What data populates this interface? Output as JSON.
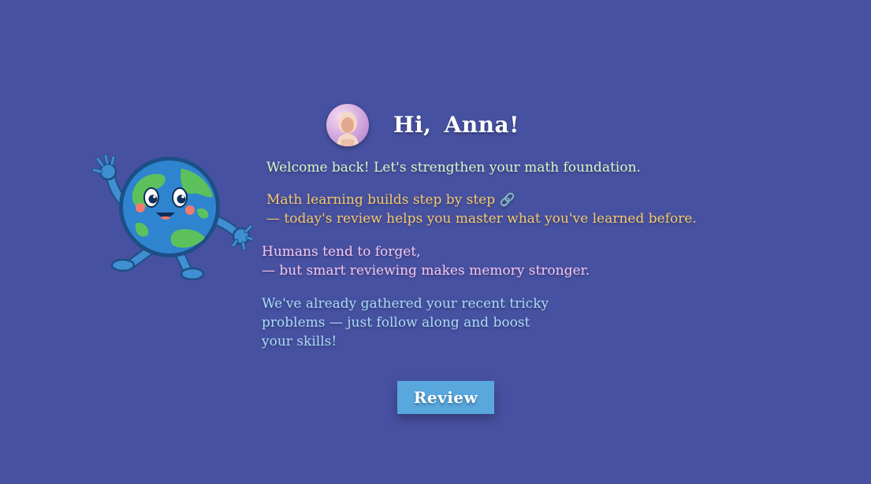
{
  "greeting": {
    "text": "Hi, Anna!"
  },
  "messages": {
    "welcome": "Welcome back! Let's strengthen your math foundation.",
    "steps_line1": "Math learning builds step by step",
    "steps_icon": "link-icon",
    "steps_line2": "— today's review helps you master what you've learned before.",
    "forget_line1": "Humans tend to forget,",
    "forget_line2": "— but smart reviewing makes memory stronger.",
    "tricky_line1": "We've already gathered your recent tricky",
    "tricky_line2": "problems — just follow along and boost",
    "tricky_line3": "your skills!"
  },
  "actions": {
    "review_label": "Review"
  },
  "images": {
    "mascot": "smiling-earth-globe-mascot",
    "avatar": "girl-avatar"
  },
  "colors": {
    "background": "#4751a1",
    "welcome_text": "#d9f7c5",
    "steps_text": "#f3c96a",
    "forget_text": "#f5c6ef",
    "tricky_text": "#a9dcf6",
    "review_button": "#58a7dd"
  }
}
